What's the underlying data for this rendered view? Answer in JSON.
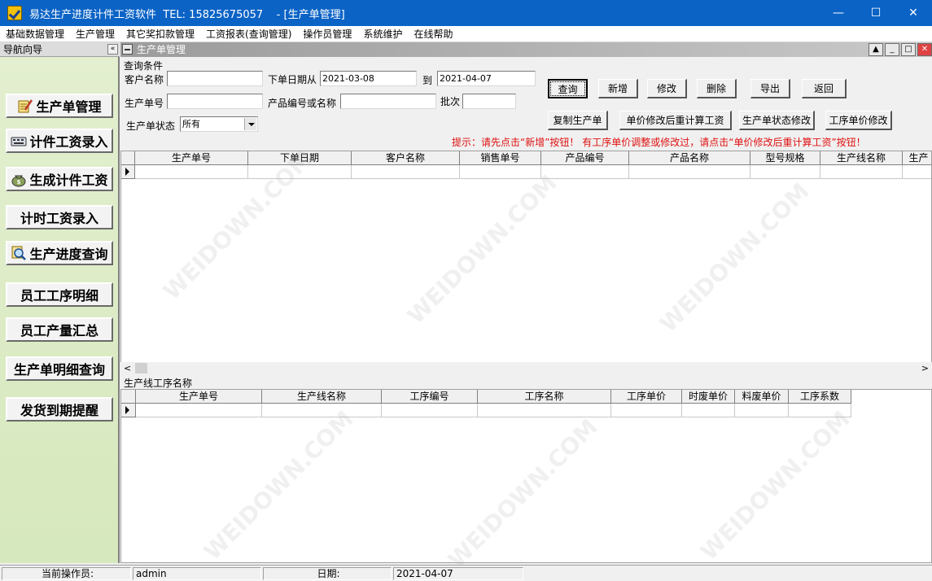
{
  "window": {
    "title": "易达生产进度计件工资软件  TEL: 15825675057    - [生产单管理]",
    "controls": {
      "minimize": "—",
      "maximize": "☐",
      "close": "✕"
    }
  },
  "menu": [
    "基础数据管理",
    "生产管理",
    "其它奖扣款管理",
    "工资报表(查询管理)",
    "操作员管理",
    "系统维护",
    "在线帮助"
  ],
  "nav": {
    "header": "导航向导",
    "collapse": "«",
    "items": [
      "生产单管理",
      "计件工资录入",
      "生成计件工资",
      "计时工资录入",
      "生产进度查询",
      "员工工序明细",
      "员工产量汇总",
      "生产单明细查询",
      "发货到期提醒"
    ]
  },
  "child": {
    "title": "生产单管理",
    "controls": {
      "up": "▲",
      "minimize": "_",
      "maximize": "□",
      "close": "✕"
    }
  },
  "query": {
    "legend": "查询条件",
    "customer_label": "客户名称",
    "customer_value": "",
    "date_from_label": "下单日期从",
    "date_from": "2021-03-08",
    "date_to_label": "到",
    "date_to": "2021-04-07",
    "order_no_label": "生产单号",
    "order_no_value": "",
    "product_label": "产品编号或名称",
    "product_value": "",
    "batch_label": "批次",
    "batch_value": "",
    "status_label": "生产单状态",
    "status_value": "所有"
  },
  "buttons": {
    "query": "查询",
    "add": "新增",
    "edit": "修改",
    "delete": "删除",
    "export": "导出",
    "back": "返回",
    "copy": "复制生产单",
    "recalc": "单价修改后重计算工资",
    "status_edit": "生产单状态修改",
    "price_edit": "工序单价修改"
  },
  "hint": "提示：请先点击“新增”按钮！  有工序单价调整或修改过，请点击“单价修改后重计算工资”按钮！",
  "main_grid": {
    "columns": [
      "生产单号",
      "下单日期",
      "客户名称",
      "销售单号",
      "产品编号",
      "产品名称",
      "型号规格",
      "生产线名称",
      "生产"
    ]
  },
  "scroll": {
    "left": "<",
    "right": ">"
  },
  "sub_grid": {
    "legend": "生产线工序名称",
    "columns": [
      "生产单号",
      "生产线名称",
      "工序编号",
      "工序名称",
      "工序单价",
      "时废单价",
      "料废单价",
      "工序系数"
    ]
  },
  "status": {
    "operator_label": "当前操作员:",
    "operator": "admin",
    "date_label": "日期:",
    "date": "2021-04-07"
  },
  "colors": {
    "titlebar": "#0b63c6",
    "hint": "#e01010",
    "nav_bg": "#dcebc5"
  }
}
